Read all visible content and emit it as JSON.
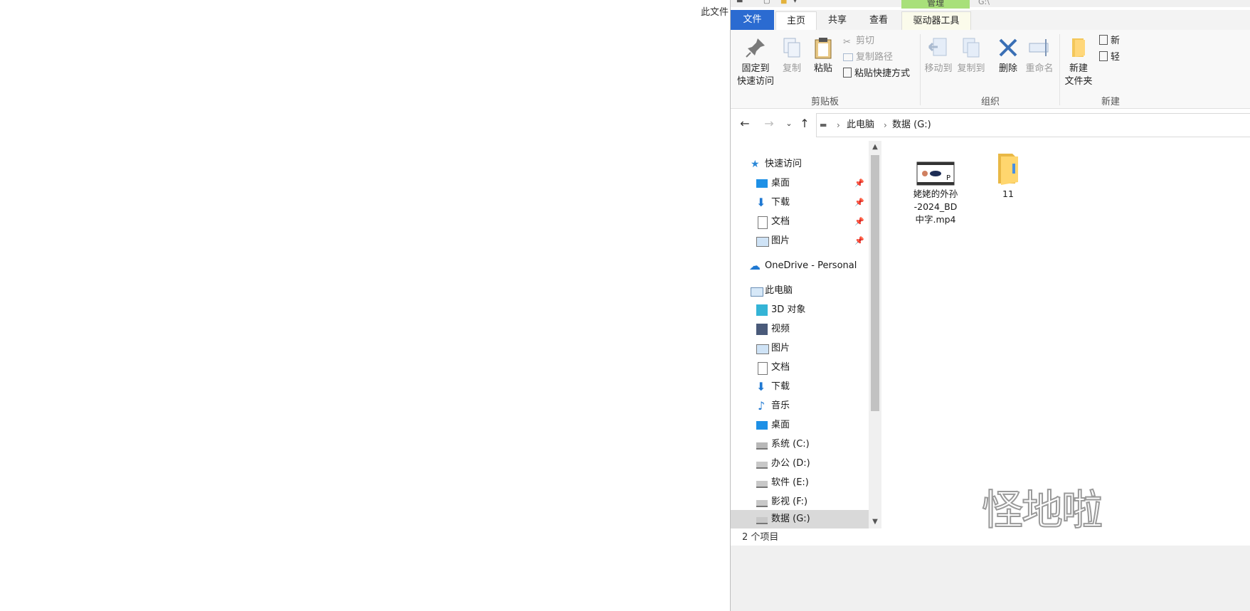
{
  "background_text": "此文件",
  "window": {
    "title_peek": "G:\\",
    "tabs": {
      "file": "文件",
      "home": "主页",
      "share": "共享",
      "view": "查看",
      "manage": "管理",
      "drive_tools": "驱动器工具"
    }
  },
  "ribbon": {
    "clipboard": {
      "pin_line1": "固定到",
      "pin_line2": "快速访问",
      "copy": "复制",
      "paste": "粘贴",
      "cut": "剪切",
      "copy_path": "复制路径",
      "paste_shortcut": "粘贴快捷方式",
      "group_label": "剪贴板"
    },
    "organize": {
      "move_to": "移动到",
      "copy_to": "复制到",
      "delete": "删除",
      "rename": "重命名",
      "group_label": "组织"
    },
    "new": {
      "new_folder_line1": "新建",
      "new_folder_line2": "文件夹",
      "new_item_peek": "新",
      "easy_access_peek": "轻",
      "group_label_peek": "新建"
    }
  },
  "address": {
    "crumbs": [
      "此电脑",
      "数据 (G:)"
    ]
  },
  "nav": {
    "quick_access": "快速访问",
    "quick_items": [
      "桌面",
      "下载",
      "文档",
      "图片"
    ],
    "onedrive": "OneDrive - Personal",
    "this_pc": "此电脑",
    "pc_items": [
      "3D 对象",
      "视频",
      "图片",
      "文档",
      "下载",
      "音乐",
      "桌面",
      "系统 (C:)",
      "办公 (D:)",
      "软件 (E:)",
      "影视 (F:)",
      "数据 (G:)"
    ]
  },
  "files": [
    {
      "name_line1": "姥姥的外孙",
      "name_line2": "-2024_BD",
      "name_line3": "中字.mp4",
      "type": "video-file-icon"
    },
    {
      "name_line1": "11",
      "type": "folder-icon"
    }
  ],
  "status": {
    "item_count": "2 个项目"
  },
  "watermark": "怪地啦"
}
